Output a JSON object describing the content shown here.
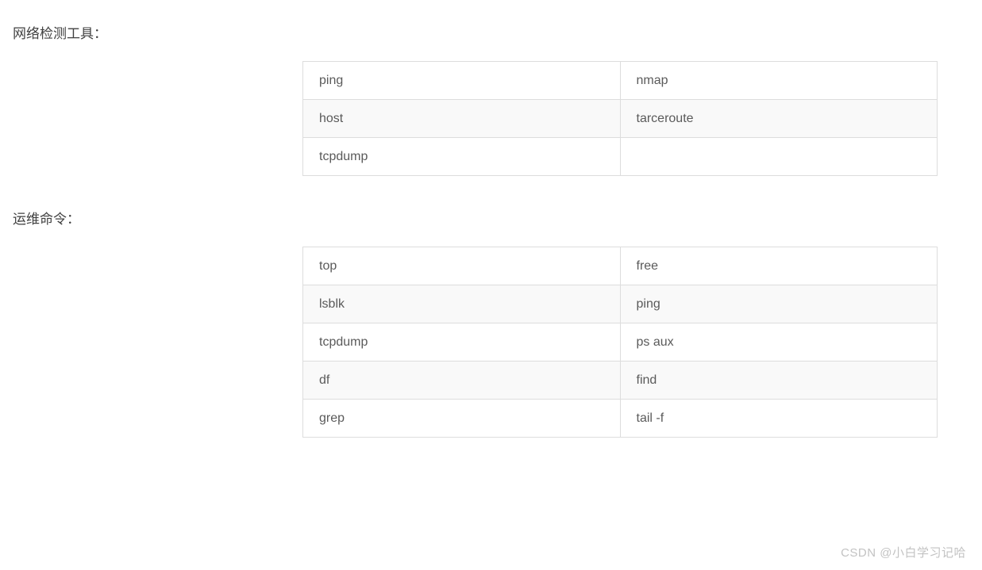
{
  "sections": [
    {
      "title": "网络检测工具：",
      "rows": [
        [
          "ping",
          "nmap"
        ],
        [
          "host",
          "tarceroute"
        ],
        [
          "tcpdump",
          ""
        ]
      ]
    },
    {
      "title": "运维命令：",
      "rows": [
        [
          "top",
          "free"
        ],
        [
          "lsblk",
          "ping"
        ],
        [
          "tcpdump",
          "ps  aux"
        ],
        [
          "df",
          "find"
        ],
        [
          "grep",
          "tail   -f"
        ]
      ]
    }
  ],
  "watermark": "CSDN @小白学习记哈"
}
